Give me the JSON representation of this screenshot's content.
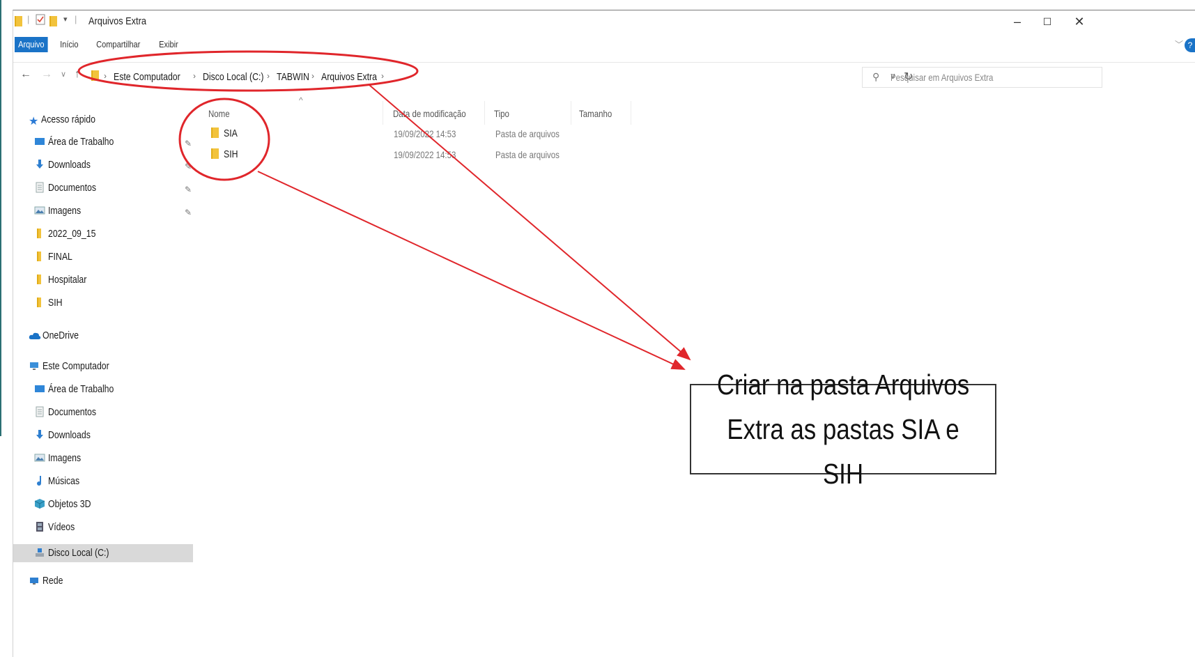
{
  "window": {
    "title": "Arquivos Extra",
    "controls": {
      "minimize": "–",
      "maximize": "☐",
      "close": "✕"
    }
  },
  "ribbon": {
    "tabs": [
      "Arquivo",
      "Início",
      "Compartilhar",
      "Exibir"
    ],
    "help": "?"
  },
  "address_bar": {
    "crumbs": [
      "Este Computador",
      "Disco Local (C:)",
      "TABWIN",
      "Arquivos Extra"
    ]
  },
  "search": {
    "placeholder": "Pesquisar em Arquivos Extra"
  },
  "nav_pane": {
    "quick_access": "Acesso rápido",
    "quick_items": [
      {
        "label": "Área de Trabalho",
        "icon": "desktop-icon",
        "pinned": true
      },
      {
        "label": "Downloads",
        "icon": "download-icon",
        "pinned": true
      },
      {
        "label": "Documentos",
        "icon": "document-icon",
        "pinned": true
      },
      {
        "label": "Imagens",
        "icon": "image-icon",
        "pinned": true
      },
      {
        "label": "2022_09_15",
        "icon": "folder-icon",
        "pinned": false
      },
      {
        "label": "FINAL",
        "icon": "folder-icon",
        "pinned": false
      },
      {
        "label": "Hospitalar",
        "icon": "folder-icon",
        "pinned": false
      },
      {
        "label": "SIH",
        "icon": "folder-icon",
        "pinned": false
      }
    ],
    "onedrive": "OneDrive",
    "this_pc": "Este Computador",
    "pc_items": [
      {
        "label": "Área de Trabalho",
        "icon": "desktop-icon"
      },
      {
        "label": "Documentos",
        "icon": "document-icon"
      },
      {
        "label": "Downloads",
        "icon": "download-icon"
      },
      {
        "label": "Imagens",
        "icon": "image-icon"
      },
      {
        "label": "Músicas",
        "icon": "music-icon"
      },
      {
        "label": "Objetos 3D",
        "icon": "cube-icon"
      },
      {
        "label": "Vídeos",
        "icon": "video-icon"
      },
      {
        "label": "Disco Local (C:)",
        "icon": "drive-icon",
        "selected": true
      }
    ],
    "network": "Rede"
  },
  "file_list": {
    "columns": [
      "Nome",
      "Data de modificação",
      "Tipo",
      "Tamanho"
    ],
    "rows": [
      {
        "name": "SIA",
        "modified": "19/09/2022 14:53",
        "type": "Pasta de arquivos"
      },
      {
        "name": "SIH",
        "modified": "19/09/2022 14:53",
        "type": "Pasta de arquivos"
      }
    ]
  },
  "annotation": {
    "text": "Criar na pasta Arquivos\nExtra as pastas SIA e SIH",
    "color": "#e0262b"
  }
}
